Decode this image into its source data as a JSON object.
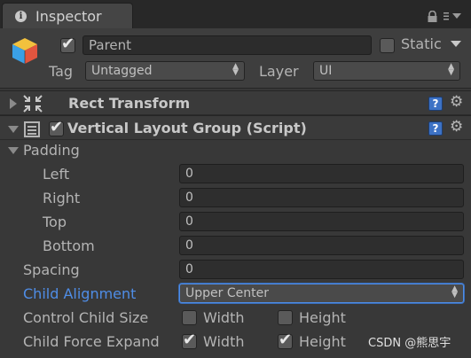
{
  "tab": {
    "title": "Inspector",
    "icon": "info-icon"
  },
  "header": {
    "active": true,
    "name": "Parent",
    "static_checked": false,
    "static_label": "Static",
    "tag_label": "Tag",
    "tag_value": "Untagged",
    "layer_label": "Layer",
    "layer_value": "UI"
  },
  "rect_transform": {
    "title": "Rect Transform",
    "expanded": false
  },
  "layout_group": {
    "title": "Vertical Layout Group (Script)",
    "enabled": true,
    "expanded": true,
    "padding": {
      "label": "Padding",
      "left_label": "Left",
      "left": "0",
      "right_label": "Right",
      "right": "0",
      "top_label": "Top",
      "top": "0",
      "bottom_label": "Bottom",
      "bottom": "0"
    },
    "spacing_label": "Spacing",
    "spacing": "0",
    "child_alignment_label": "Child Alignment",
    "child_alignment": "Upper Center",
    "control_child_size_label": "Control Child Size",
    "control_width_label": "Width",
    "control_width": false,
    "control_height_label": "Height",
    "control_height": false,
    "child_force_expand_label": "Child Force Expand",
    "expand_width_label": "Width",
    "expand_width": true,
    "expand_height_label": "Height",
    "expand_height": true
  },
  "watermark": "CSDN @熊思宇",
  "colors": {
    "background": "#383838",
    "accent": "#4f8de6",
    "help": "#3d72c5"
  }
}
